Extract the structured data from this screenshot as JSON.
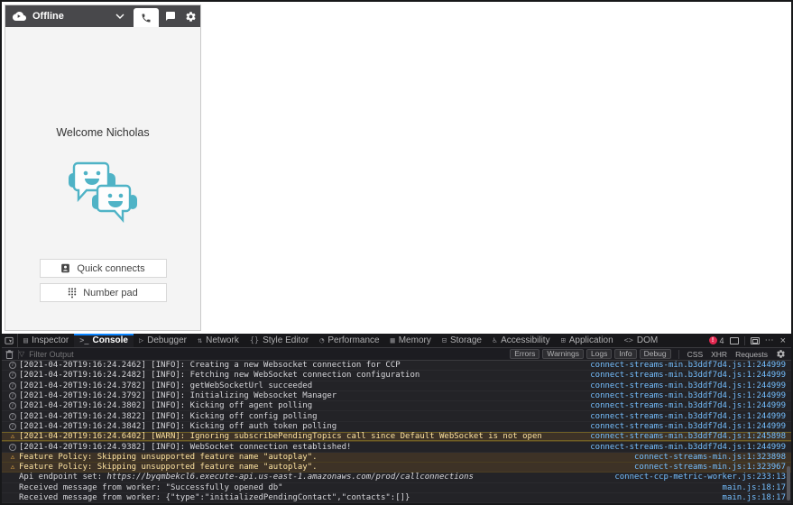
{
  "ccp": {
    "status_label": "Offline",
    "welcome": "Welcome Nicholas",
    "quick_connects_label": "Quick connects",
    "number_pad_label": "Number pad"
  },
  "devtools": {
    "tabs": [
      {
        "label": "Inspector",
        "glyph": "▤",
        "selected": false
      },
      {
        "label": "Console",
        "glyph": ">_",
        "selected": true
      },
      {
        "label": "Debugger",
        "glyph": "▷",
        "selected": false
      },
      {
        "label": "Network",
        "glyph": "⇅",
        "selected": false
      },
      {
        "label": "Style Editor",
        "glyph": "{}",
        "selected": false
      },
      {
        "label": "Performance",
        "glyph": "◔",
        "selected": false
      },
      {
        "label": "Memory",
        "glyph": "▦",
        "selected": false
      },
      {
        "label": "Storage",
        "glyph": "⊟",
        "selected": false
      },
      {
        "label": "Accessibility",
        "glyph": "♿",
        "selected": false
      },
      {
        "label": "Application",
        "glyph": "⊞",
        "selected": false
      },
      {
        "label": "DOM",
        "glyph": "<>",
        "selected": false
      }
    ],
    "error_badge_count": "4",
    "toolbar_dots": "⋯",
    "toolbar_close": "×",
    "filter": {
      "placeholder": "Filter Output",
      "funnel_glyph": "▽",
      "levels": [
        "Errors",
        "Warnings",
        "Logs",
        "Info",
        "Debug"
      ],
      "categories": [
        "CSS",
        "XHR",
        "Requests"
      ]
    },
    "console_rows": [
      {
        "level": "info",
        "text": "[2021-04-20T19:16:24.2462] [INFO]: Creating a new Websocket connection for CCP",
        "source": "connect-streams-min.b3ddf7d4.js:1:244999"
      },
      {
        "level": "info",
        "text": "[2021-04-20T19:16:24.2482] [INFO]: Fetching new WebSocket connection configuration",
        "source": "connect-streams-min.b3ddf7d4.js:1:244999"
      },
      {
        "level": "info",
        "text": "[2021-04-20T19:16:24.3782] [INFO]: getWebSocketUrl succeeded",
        "source": "connect-streams-min.b3ddf7d4.js:1:244999"
      },
      {
        "level": "info",
        "text": "[2021-04-20T19:16:24.3792] [INFO]: Initializing Websocket Manager",
        "source": "connect-streams-min.b3ddf7d4.js:1:244999"
      },
      {
        "level": "info",
        "text": "[2021-04-20T19:16:24.3802] [INFO]: Kicking off agent polling",
        "source": "connect-streams-min.b3ddf7d4.js:1:244999"
      },
      {
        "level": "info",
        "text": "[2021-04-20T19:16:24.3822] [INFO]: Kicking off config polling",
        "source": "connect-streams-min.b3ddf7d4.js:1:244999"
      },
      {
        "level": "info",
        "text": "[2021-04-20T19:16:24.3842] [INFO]: Kicking off auth token polling",
        "source": "connect-streams-min.b3ddf7d4.js:1:244999"
      },
      {
        "level": "warn-strong",
        "text": "[2021-04-20T19:16:24.6402] [WARN]: Ignoring subscribePendingTopics call since Default WebSocket is not open",
        "source": "connect-streams-min.b3ddf7d4.js:1:245898"
      },
      {
        "level": "info",
        "text": "[2021-04-20T19:16:24.9382] [INFO]: WebSocket connection established!",
        "source": "connect-streams-min.b3ddf7d4.js:1:244999"
      },
      {
        "level": "warn",
        "text": "Feature Policy: Skipping unsupported feature name \"autoplay\".",
        "source": "connect-streams-min.js:1:323898"
      },
      {
        "level": "warn",
        "text": "Feature Policy: Skipping unsupported feature name \"autoplay\".",
        "source": "connect-streams-min.js:1:323967"
      },
      {
        "level": "log",
        "text": "Api endpoint set: ",
        "url": "https://byqmbekcl6.execute-api.us-east-1.amazonaws.com/prod/callconnections",
        "source": "connect-ccp-metric-worker.js:233:13"
      },
      {
        "level": "log",
        "text": "Received message from worker: \"Successfully opened db\"",
        "source": "main.js:18:17"
      },
      {
        "level": "log",
        "text": "Received message from worker: {\"type\":\"initializedPendingContact\",\"contacts\":[]}",
        "source": "main.js:18:17"
      }
    ]
  },
  "colors": {
    "accent_teal": "#4fb3c6",
    "header_gray": "#48484b",
    "devtools_link_blue": "#75bfff",
    "warn_text": "#fce2a0",
    "error_red": "#e22850",
    "tab_accent_blue": "#0a84ff"
  }
}
